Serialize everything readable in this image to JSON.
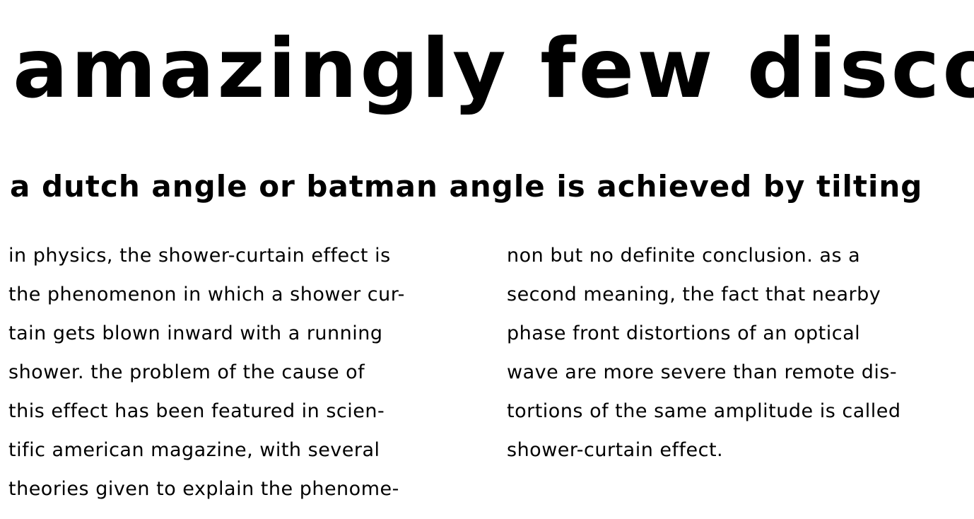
{
  "headline": "amazingly few discothe",
  "subheadline": "a dutch angle or batman angle is achieved by tilting",
  "column_left": [
    "in physics, the shower-curtain effect is",
    "the phenomenon in which a shower cur-",
    "tain gets blown inward with a running",
    "shower. the problem of the cause of",
    "this effect has been featured in scien-",
    "tific american magazine, with several",
    "theories given to explain the phenome-"
  ],
  "column_right": [
    "non but no definite conclusion. as a",
    "second meaning, the fact that nearby",
    "phase front distortions of an optical",
    "wave are more severe than remote dis-",
    "tortions of the same amplitude is called",
    "shower-curtain effect."
  ]
}
